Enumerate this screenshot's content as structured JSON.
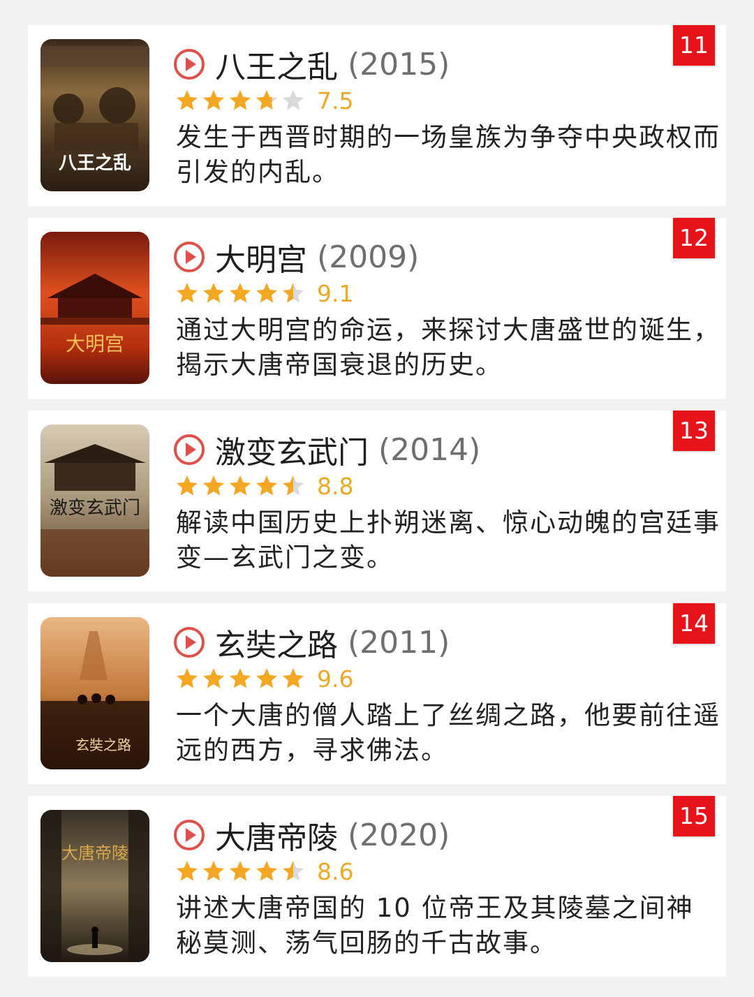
{
  "items": [
    {
      "rank": "11",
      "title": "八王之乱",
      "year": "(2015)",
      "rating": 3.75,
      "score": "7.5",
      "description": "发生于西晋时期的一场皇族为争夺中央政权而引发的内乱。",
      "poster_text": "八王之乱",
      "poster_icon": "war-battle-poster"
    },
    {
      "rank": "12",
      "title": "大明宫",
      "year": "(2009)",
      "rating": 4.5,
      "score": "9.1",
      "description": "通过大明宫的命运，来探讨大唐盛世的诞生，揭示大唐帝国衰退的历史。",
      "poster_text": "大明宫",
      "poster_icon": "palace-sunset-poster"
    },
    {
      "rank": "13",
      "title": "激变玄武门",
      "year": "(2014)",
      "rating": 4.5,
      "score": "8.8",
      "description": "解读中国历史上扑朔迷离、惊心动魄的宫廷事变—玄武门之变。",
      "poster_text": "激变玄武门",
      "poster_icon": "gate-roof-poster"
    },
    {
      "rank": "14",
      "title": "玄奘之路",
      "year": "(2011)",
      "rating": 5,
      "score": "9.6",
      "description": "一个大唐的僧人踏上了丝绸之路，他要前往遥远的西方，寻求佛法。",
      "poster_text": "玄奘之路",
      "poster_icon": "desert-pilgrims-poster"
    },
    {
      "rank": "15",
      "title": "大唐帝陵",
      "year": "(2020)",
      "rating": 4.5,
      "score": "8.6",
      "description": "讲述大唐帝国的 10 位帝王及其陵墓之间神秘莫测、荡气回肠的千古故事。",
      "poster_text": "大唐帝陵",
      "poster_icon": "tomb-passage-poster"
    }
  ],
  "colors": {
    "background": "#f1f1f1",
    "card": "#ffffff",
    "rank_badge": "#e8121b",
    "play_icon": "#e0504a",
    "star": "#f5a623",
    "star_empty": "#d9d9d9",
    "score": "#f0a824",
    "title": "#1e1e1e",
    "year": "#6e6e6e"
  }
}
